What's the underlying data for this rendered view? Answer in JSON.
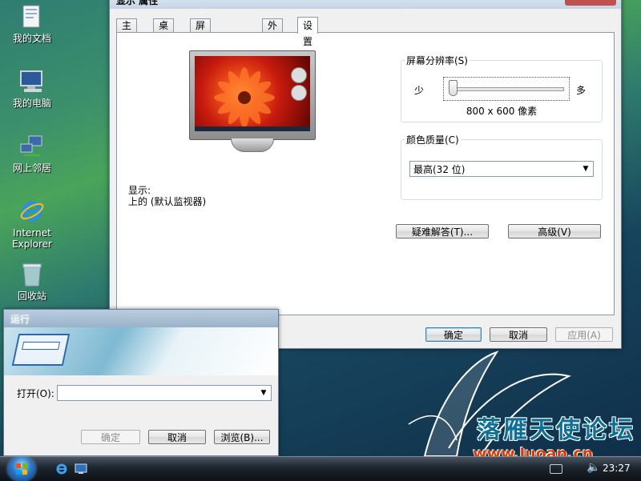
{
  "desktop": {
    "icons": [
      {
        "label": "我的文档"
      },
      {
        "label": "我的电脑"
      },
      {
        "label": "网上邻居"
      },
      {
        "label": "Internet Explorer"
      },
      {
        "label": "回收站"
      }
    ]
  },
  "wallpaper": {
    "text": "落雁天使论坛",
    "url": "www.luoan.cn"
  },
  "dialog": {
    "title": "显示 属性",
    "tabs": [
      "主题",
      "桌面",
      "屏幕保护程序",
      "外观",
      "设置"
    ],
    "active_tab": "设置",
    "display_label": "显示:",
    "display_value": "上的 (默认监视器)",
    "resolution": {
      "legend": "屏幕分辨率(S)",
      "min_label": "少",
      "max_label": "多",
      "slider_level": 0,
      "value": "800 x 600 像素"
    },
    "color_quality": {
      "legend": "颜色质量(C)",
      "selected": "最高(32 位)"
    },
    "buttons": {
      "troubleshoot": "疑难解答(T)...",
      "advanced": "高级(V)",
      "ok": "确定",
      "cancel": "取消",
      "apply": "应用(A)"
    }
  },
  "run_dialog": {
    "title": "运行",
    "open_label": "打开(O):",
    "open_value": "",
    "buttons": {
      "ok": "确定",
      "cancel": "取消",
      "browse": "浏览(B)..."
    }
  },
  "taskbar": {
    "clock": "23:27"
  },
  "colors": {
    "accent": "#2b67b1",
    "taskbar": "#1c242d"
  }
}
